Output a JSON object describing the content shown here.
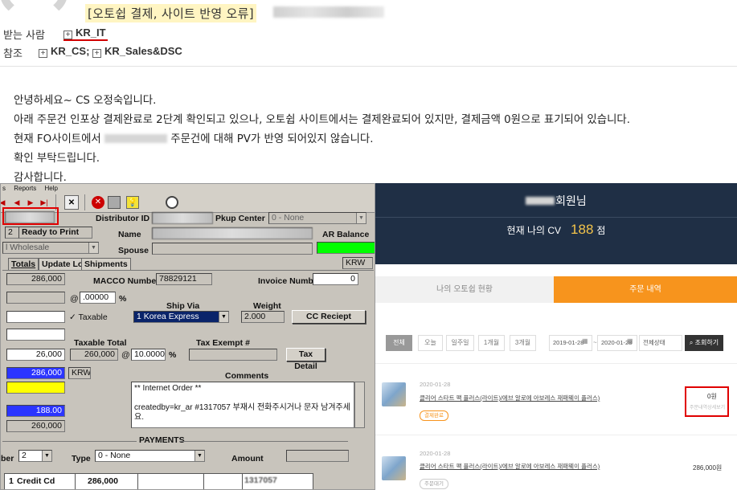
{
  "email": {
    "subject": "[오토쉽 결제, 사이트 반영 오류]",
    "to_label": "받는 사람",
    "to_recipient": "KR_IT",
    "cc_label": "참조",
    "cc_recipients": [
      "KR_CS;",
      "KR_Sales&DSC"
    ],
    "body": [
      "안녕하세요~ CS 오정숙입니다.",
      "아래 주문건 인포상 결제완료로 2단계 확인되고 있으나, 오토쉽 사이트에서는 결제완료되어 있지만, 결제금액 0원으로 표기되어 있습니다.",
      "현재 FO사이트에서",
      "주문건에 대해 PV가 반영 되어있지 않습니다.",
      "확인 부탁드립니다.",
      "감사합니다."
    ]
  },
  "erp": {
    "menu": [
      "s",
      "Reports",
      "Help"
    ],
    "status_num": "2",
    "status_text": "Ready to Print",
    "order_type": "l Wholesale",
    "distributor_id_label": "Distributor ID",
    "pkup_center_label": "Pkup Center",
    "pkup_center_value": "0 - None",
    "name_label": "Name",
    "ar_balance_label": "AR Balance",
    "spouse_label": "Spouse",
    "tabs": [
      "Totals",
      "Update Log",
      "Shipments"
    ],
    "currency": "KRW",
    "total_1": "286,000",
    "macco_label": "MACCO Number",
    "macco_value": "78829121",
    "invoice_label": "Invoice Number",
    "invoice_value": "0",
    "rate_value": ".00000",
    "pct": "%",
    "at": "@",
    "taxable_label": "Taxable",
    "ship_via_label": "Ship Via",
    "ship_via_value": "1 Korea Express",
    "weight_label": "Weight",
    "weight_value": "2.000",
    "cc_receipt_label": "CC Reciept",
    "taxable_total_label": "Taxable Total",
    "tax_exempt_label": "Tax Exempt #",
    "tax_value": "26,000",
    "taxable_total_value": "260,000",
    "tax_rate_value": "10.00000",
    "tax_detail_label": "Tax Detail",
    "amount_blue_1": "286,000",
    "amount_currency": "KRW",
    "comments_label": "Comments",
    "comments_text": "** Internet Order **\n\ncreatedby=kr_ar #1317057 부재시 전화주시거나 문자 남겨주세요.",
    "amount_blue_2": "188.00",
    "amount_total_3": "260,000",
    "payments_label": "PAYMENTS",
    "pay_number_label": "ber",
    "pay_number_value": "2",
    "pay_type_label": "Type",
    "pay_type_value": "0 - None",
    "pay_amount_label": "Amount",
    "pay_row_num": "1",
    "pay_row_method": "Credit Cd",
    "pay_row_amount": "286,000",
    "pay_row_ref": "1317057"
  },
  "web": {
    "member_suffix": "회원님",
    "cv_label": "현재 나의 CV",
    "cv_value": "188",
    "cv_unit": "점",
    "tab_1": "나의 오토쉽 현황",
    "tab_2": "주문 내역",
    "filters": [
      "전체",
      "오늘",
      "일주일",
      "1개월",
      "3개월"
    ],
    "date_from": "2019-01-28",
    "date_to": "2020-01-28",
    "date_sep": "~",
    "status_select": "전체상태",
    "search_label": "조회하기",
    "orders": [
      {
        "date": "2020-01-28",
        "title": "클리어 스타트 팩 플러스(라이트)/에브 알로에 아보레스 재패웨이 플러스)",
        "badge": "결제완료",
        "price": "0원",
        "sub": "주문내역상세보기"
      },
      {
        "date": "2020-01-28",
        "title": "클리어 스타트 팩 플러스(라이트)/에브 알로에 아보레스 재패웨이 플러스)",
        "badge": "주문대기",
        "price": "286,000원",
        "sub": ""
      }
    ]
  }
}
